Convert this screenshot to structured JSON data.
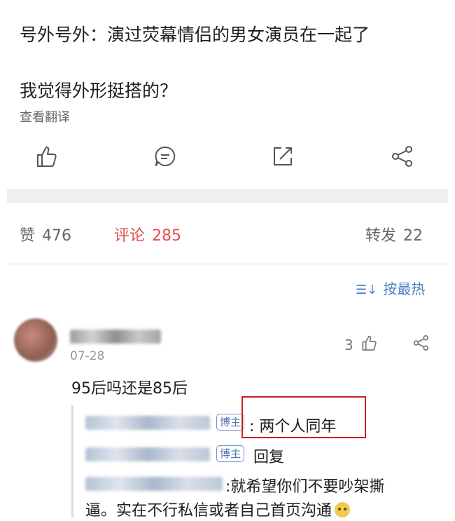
{
  "post": {
    "line1": "号外号外：演过荧幕情侣的男女演员在一起了",
    "line2": "我觉得外形挺搭的？",
    "translate": "查看翻译"
  },
  "actions": {
    "icons": [
      "thumb-up-icon",
      "comment-icon",
      "share-out-icon",
      "share-network-icon"
    ]
  },
  "stats": {
    "likes_label": "赞",
    "likes_count": "476",
    "comments_label": "评论",
    "comments_count": "285",
    "reposts_label": "转发",
    "reposts_count": "22"
  },
  "sort": {
    "icon": "sort-icon",
    "label": "按最热"
  },
  "comment": {
    "date": "07-28",
    "like_count": "3",
    "text": "95后吗还是85后",
    "replies": [
      {
        "badge": "博主",
        "text": ": 两个人同年"
      },
      {
        "badge": "博主",
        "text": "回复"
      },
      {
        "text_line1": ":就希望你们不要吵架撕",
        "text_line2": "逼。实在不行私信或者自己首页沟通"
      }
    ]
  },
  "colors": {
    "accent_red": "#e3504b",
    "link_blue": "#4a7fc1",
    "highlight_box": "#c9201e"
  }
}
